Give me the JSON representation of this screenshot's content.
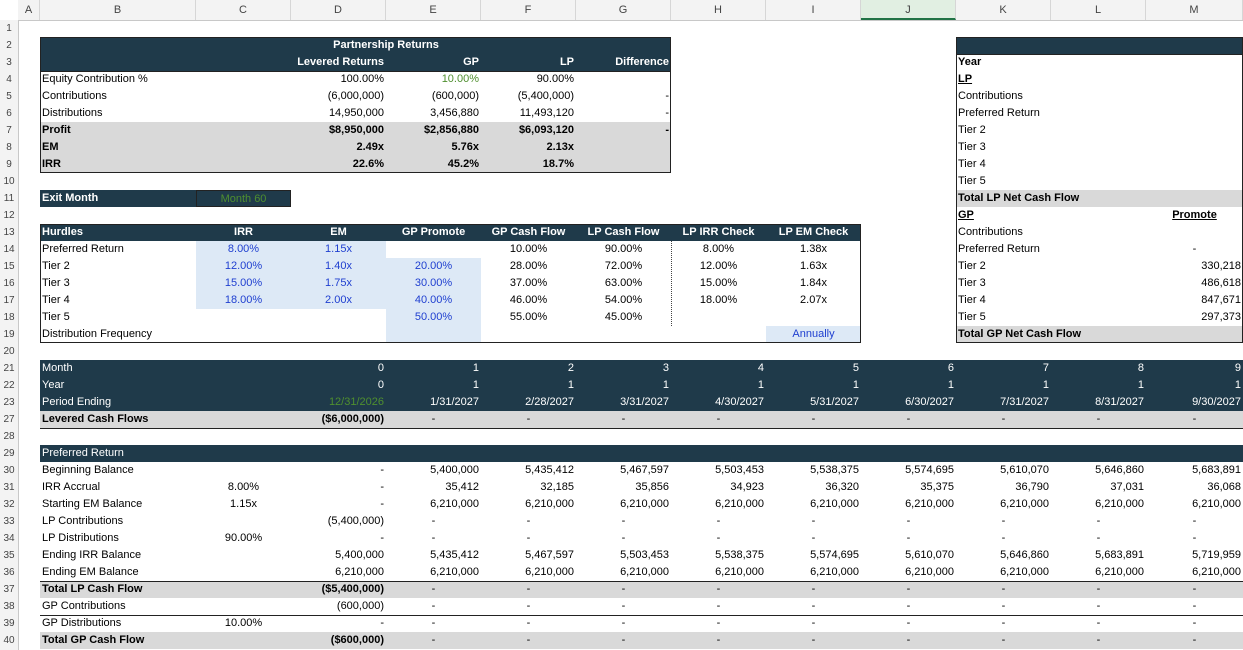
{
  "columns": [
    "A",
    "B",
    "C",
    "D",
    "E",
    "F",
    "G",
    "H",
    "I",
    "J",
    "K",
    "L",
    "M"
  ],
  "rows": [
    "1",
    "2",
    "3",
    "4",
    "5",
    "6",
    "7",
    "8",
    "9",
    "10",
    "11",
    "12",
    "13",
    "14",
    "15",
    "16",
    "17",
    "18",
    "19",
    "20",
    "21",
    "22",
    "23",
    "27",
    "28",
    "29",
    "30",
    "31",
    "32",
    "33",
    "34",
    "35",
    "36",
    "37",
    "38",
    "39",
    "40"
  ],
  "partnership": {
    "title": "Partnership Returns",
    "headers": [
      "Levered Returns",
      "GP",
      "LP",
      "Difference"
    ],
    "rows": [
      {
        "label": "Equity Contribution %",
        "lev": "100.00%",
        "gp": "10.00%",
        "lp": "90.00%",
        "diff": ""
      },
      {
        "label": "Contributions",
        "lev": "(6,000,000)",
        "gp": "(600,000)",
        "lp": "(5,400,000)",
        "diff": "-"
      },
      {
        "label": "Distributions",
        "lev": "14,950,000",
        "gp": "3,456,880",
        "lp": "11,493,120",
        "diff": "-"
      },
      {
        "label": "Profit",
        "lev": "$8,950,000",
        "gp": "$2,856,880",
        "lp": "$6,093,120",
        "diff": "-"
      },
      {
        "label": "EM",
        "lev": "2.49x",
        "gp": "5.76x",
        "lp": "2.13x",
        "diff": ""
      },
      {
        "label": "IRR",
        "lev": "22.6%",
        "gp": "45.2%",
        "lp": "18.7%",
        "diff": ""
      }
    ]
  },
  "exit": {
    "label": "Exit Month",
    "value": "Month 60"
  },
  "hurdles": {
    "headers": [
      "Hurdles",
      "IRR",
      "EM",
      "GP Promote",
      "GP Cash Flow",
      "LP Cash Flow",
      "LP IRR Check",
      "LP EM Check"
    ],
    "rows": [
      {
        "label": "Preferred Return",
        "irr": "8.00%",
        "em": "1.15x",
        "promote": "",
        "gpcf": "10.00%",
        "lpcf": "90.00%",
        "irrchk": "8.00%",
        "emchk": "1.38x"
      },
      {
        "label": "Tier 2",
        "irr": "12.00%",
        "em": "1.40x",
        "promote": "20.00%",
        "gpcf": "28.00%",
        "lpcf": "72.00%",
        "irrchk": "12.00%",
        "emchk": "1.63x"
      },
      {
        "label": "Tier 3",
        "irr": "15.00%",
        "em": "1.75x",
        "promote": "30.00%",
        "gpcf": "37.00%",
        "lpcf": "63.00%",
        "irrchk": "15.00%",
        "emchk": "1.84x"
      },
      {
        "label": "Tier 4",
        "irr": "18.00%",
        "em": "2.00x",
        "promote": "40.00%",
        "gpcf": "46.00%",
        "lpcf": "54.00%",
        "irrchk": "18.00%",
        "emchk": "2.07x"
      },
      {
        "label": "Tier 5",
        "irr": "",
        "em": "",
        "promote": "50.00%",
        "gpcf": "55.00%",
        "lpcf": "45.00%",
        "irrchk": "",
        "emchk": ""
      }
    ],
    "freq_label": "Distribution Frequency",
    "freq_value": "Annually"
  },
  "right_panel": {
    "year": "Year",
    "lp": "LP",
    "contributions": "Contributions",
    "pref": "Preferred Return",
    "tiers": [
      "Tier 2",
      "Tier 3",
      "Tier 4",
      "Tier 5"
    ],
    "total_lp": "Total LP Net Cash Flow",
    "gp": "GP",
    "promote": "Promote",
    "gp_contrib": "Contributions",
    "gp_pref": "Preferred Return",
    "gp_pref_val": "-",
    "gp_tier_vals": [
      "330,218",
      "486,618",
      "847,671",
      "297,373"
    ],
    "total_gp": "Total GP Net Cash Flow"
  },
  "timeline": {
    "labels": [
      "Month",
      "Year",
      "Period Ending",
      "Levered Cash Flows"
    ],
    "months": [
      "0",
      "1",
      "2",
      "3",
      "4",
      "5",
      "6",
      "7",
      "8",
      "9"
    ],
    "years": [
      "0",
      "1",
      "1",
      "1",
      "1",
      "1",
      "1",
      "1",
      "1",
      "1"
    ],
    "periods": [
      "12/31/2026",
      "1/31/2027",
      "2/28/2027",
      "3/31/2027",
      "4/30/2027",
      "5/31/2027",
      "6/30/2027",
      "7/31/2027",
      "8/31/2027",
      "9/30/2027"
    ],
    "levered": [
      "($6,000,000)",
      "-",
      "-",
      "-",
      "-",
      "-",
      "-",
      "-",
      "-",
      "-"
    ]
  },
  "pref": {
    "title": "Preferred Return",
    "rows": [
      {
        "label": "Beginning Balance",
        "c": "",
        "vals": [
          "-",
          "5,400,000",
          "5,435,412",
          "5,467,597",
          "5,503,453",
          "5,538,375",
          "5,574,695",
          "5,610,070",
          "5,646,860",
          "5,683,891"
        ]
      },
      {
        "label": "IRR Accrual",
        "c": "8.00%",
        "vals": [
          "-",
          "35,412",
          "32,185",
          "35,856",
          "34,923",
          "36,320",
          "35,375",
          "36,790",
          "37,031",
          "36,068"
        ]
      },
      {
        "label": "Starting EM Balance",
        "c": "1.15x",
        "vals": [
          "-",
          "6,210,000",
          "6,210,000",
          "6,210,000",
          "6,210,000",
          "6,210,000",
          "6,210,000",
          "6,210,000",
          "6,210,000",
          "6,210,000"
        ]
      },
      {
        "label": "LP Contributions",
        "c": "",
        "vals": [
          "(5,400,000)",
          "-",
          "-",
          "-",
          "-",
          "-",
          "-",
          "-",
          "-",
          "-"
        ]
      },
      {
        "label": "LP Distributions",
        "c": "90.00%",
        "vals": [
          "-",
          "-",
          "-",
          "-",
          "-",
          "-",
          "-",
          "-",
          "-",
          "-"
        ]
      },
      {
        "label": "Ending IRR Balance",
        "c": "",
        "vals": [
          "5,400,000",
          "5,435,412",
          "5,467,597",
          "5,503,453",
          "5,538,375",
          "5,574,695",
          "5,610,070",
          "5,646,860",
          "5,683,891",
          "5,719,959"
        ]
      },
      {
        "label": "Ending EM Balance",
        "c": "",
        "vals": [
          "6,210,000",
          "6,210,000",
          "6,210,000",
          "6,210,000",
          "6,210,000",
          "6,210,000",
          "6,210,000",
          "6,210,000",
          "6,210,000",
          "6,210,000"
        ]
      },
      {
        "label": "Total LP Cash Flow",
        "c": "",
        "vals": [
          "($5,400,000)",
          "-",
          "-",
          "-",
          "-",
          "-",
          "-",
          "-",
          "-",
          "-"
        ]
      },
      {
        "label": "GP Contributions",
        "c": "",
        "vals": [
          "(600,000)",
          "-",
          "-",
          "-",
          "-",
          "-",
          "-",
          "-",
          "-",
          "-"
        ]
      },
      {
        "label": "GP Distributions",
        "c": "10.00%",
        "vals": [
          "-",
          "-",
          "-",
          "-",
          "-",
          "-",
          "-",
          "-",
          "-",
          "-"
        ]
      },
      {
        "label": "Total GP Cash Flow",
        "c": "",
        "vals": [
          "($600,000)",
          "-",
          "-",
          "-",
          "-",
          "-",
          "-",
          "-",
          "-",
          "-"
        ]
      }
    ]
  }
}
